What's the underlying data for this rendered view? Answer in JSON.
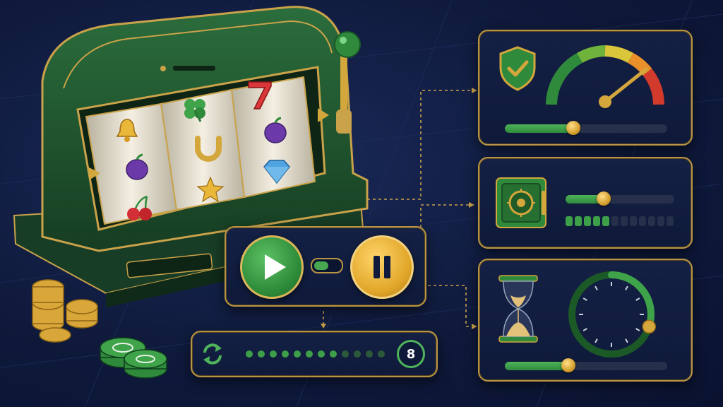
{
  "colors": {
    "accent_gold": "#d4a73c",
    "accent_green": "#3da049",
    "background": "#0f1a3c",
    "panel": "#121d40"
  },
  "slot_machine": {
    "symbols": [
      [
        "bell-icon",
        "clover-icon",
        "seven-icon"
      ],
      [
        "plum-icon",
        "horseshoe-icon",
        "plum-icon"
      ],
      [
        "cherries-icon",
        "star-icon",
        "diamond-icon"
      ]
    ],
    "lever_icon": "lever-icon"
  },
  "control_panel": {
    "play_icon": "play-icon",
    "pause_icon": "pause-icon",
    "toggle_on": true
  },
  "spin_counter": {
    "icon": "refresh-icon",
    "value": "8",
    "dots_total": 12,
    "dots_filled": 8
  },
  "limit_panel": {
    "icon": "shield-check-icon",
    "gauge_icon": "speedometer-icon",
    "slider_level": 0.42
  },
  "deposit_panel": {
    "icon": "safe-icon",
    "slider_level": 0.35,
    "segments_total": 12,
    "segments_filled": 5
  },
  "time_panel": {
    "icon": "hourglass-icon",
    "timer_icon": "timer-dial-icon",
    "timer_level": 0.3,
    "slider_level": 0.39
  }
}
